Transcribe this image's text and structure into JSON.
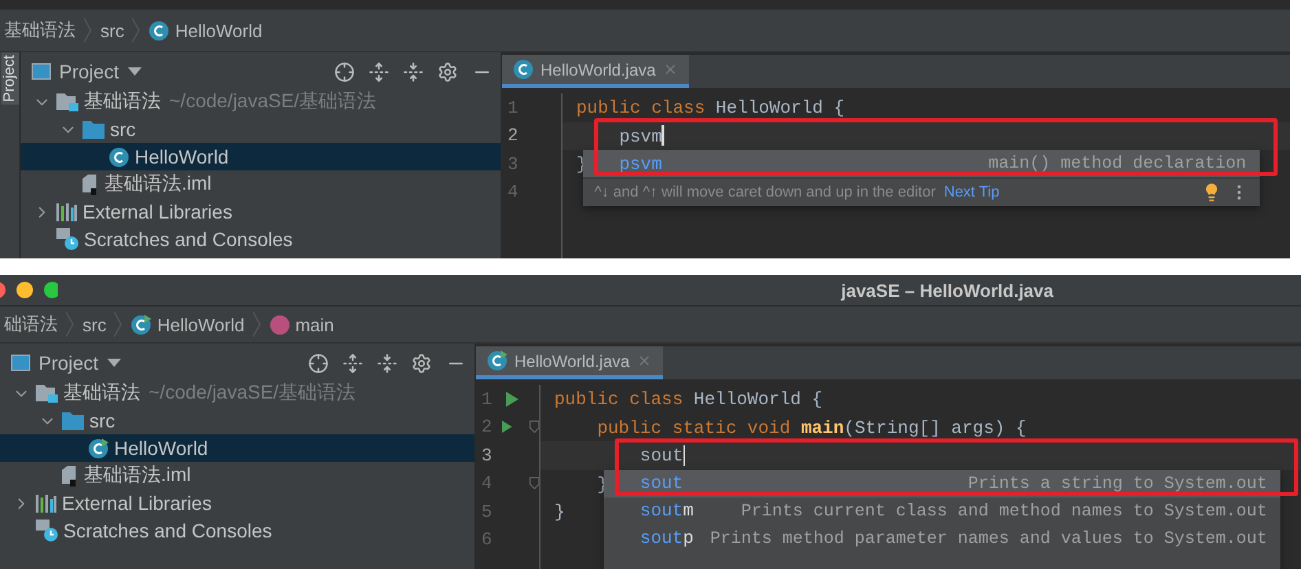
{
  "panels": [
    {
      "kind": "tip",
      "side_tab": "Project",
      "breadcrumbs": [
        {
          "text": "基础语法",
          "kind": "plain"
        },
        {
          "text": "src",
          "kind": "plain"
        },
        {
          "text": "HelloWorld",
          "kind": "class"
        }
      ],
      "project": {
        "title": "Project",
        "tree": [
          {
            "label": "基础语法",
            "hint": "~/code/javaSE/基础语法",
            "kind": "module",
            "expanded": true,
            "selected": false,
            "children": [
              {
                "label": "src",
                "kind": "folder",
                "expanded": true,
                "selected": false,
                "children": [
                  {
                    "label": "HelloWorld",
                    "kind": "class",
                    "selected": true
                  }
                ]
              },
              {
                "label": "基础语法.iml",
                "kind": "file",
                "selected": false
              }
            ]
          },
          {
            "label": "External Libraries",
            "kind": "library",
            "expanded": false,
            "selected": false
          },
          {
            "label": "Scratches and Consoles",
            "kind": "scratches",
            "selected": false
          }
        ]
      },
      "editor": {
        "tab": "HelloWorld.java",
        "lines": [
          {
            "number": "1",
            "current": false,
            "caret": false,
            "tokens": [
              {
                "text": "public class ",
                "kind": "keyword"
              },
              {
                "text": "HelloWorld {",
                "kind": "plain"
              }
            ]
          },
          {
            "number": "2",
            "current": true,
            "caret": true,
            "tokens": [
              {
                "text": "    psvm",
                "kind": "plain"
              }
            ]
          },
          {
            "number": "3",
            "current": false,
            "caret": false,
            "tokens": [
              {
                "text": "}",
                "kind": "plain"
              }
            ]
          },
          {
            "number": "4",
            "current": false,
            "caret": false
          }
        ],
        "completion": {
          "framed": true,
          "items": [
            {
              "match": "psvm",
              "description": "main() method declaration",
              "selected": true
            }
          ],
          "tip": {
            "text": "^↓ and ^↑ will move caret down and up in the editor",
            "link": "Next Tip"
          }
        }
      }
    },
    {
      "kind": "window",
      "window_title": "javaSE – HelloWorld.java",
      "breadcrumbs": [
        {
          "text": "础语法",
          "kind": "plain"
        },
        {
          "text": "src",
          "kind": "plain"
        },
        {
          "text": "HelloWorld",
          "kind": "runclass"
        },
        {
          "text": "main",
          "kind": "method"
        }
      ],
      "project": {
        "title": "Project",
        "tree": [
          {
            "label": "基础语法",
            "hint": "~/code/javaSE/基础语法",
            "kind": "module",
            "expanded": true,
            "selected": false,
            "children": [
              {
                "label": "src",
                "kind": "folder",
                "expanded": true,
                "selected": false,
                "children": [
                  {
                    "label": "HelloWorld",
                    "kind": "runclass",
                    "selected": true
                  }
                ]
              },
              {
                "label": "基础语法.iml",
                "kind": "file",
                "selected": false
              }
            ]
          },
          {
            "label": "External Libraries",
            "kind": "library",
            "expanded": false,
            "selected": false
          },
          {
            "label": "Scratches and Consoles",
            "kind": "scratches",
            "selected": false
          }
        ]
      },
      "editor": {
        "tab": "HelloWorld.java",
        "lines": [
          {
            "number": "1",
            "current": false,
            "caret": false,
            "run": true,
            "fold": false,
            "tokens": [
              {
                "text": "public class ",
                "kind": "keyword"
              },
              {
                "text": "HelloWorld {",
                "kind": "plain"
              }
            ]
          },
          {
            "number": "2",
            "current": false,
            "caret": false,
            "run": true,
            "fold": true,
            "tokens": [
              {
                "text": "    public static void ",
                "kind": "keyword"
              },
              {
                "text": "main",
                "kind": "method"
              },
              {
                "text": "(String[] args) {",
                "kind": "plain"
              }
            ]
          },
          {
            "number": "3",
            "current": true,
            "caret": true,
            "run": false,
            "fold": false,
            "tokens": [
              {
                "text": "        sout",
                "kind": "plain"
              }
            ]
          },
          {
            "number": "4",
            "current": false,
            "caret": false,
            "run": false,
            "fold": true,
            "tokens": [
              {
                "text": "    }",
                "kind": "plain"
              }
            ]
          },
          {
            "number": "5",
            "current": false,
            "caret": false,
            "run": false,
            "fold": false,
            "tokens": [
              {
                "text": "}",
                "kind": "plain"
              }
            ]
          },
          {
            "number": "6",
            "current": false,
            "caret": false,
            "run": false,
            "fold": false
          }
        ],
        "completion": {
          "framed": true,
          "items": [
            {
              "match": "sout",
              "description": "Prints a string to System.out",
              "selected": true
            },
            {
              "match": "sout",
              "rest": "m",
              "description": "Prints current class and method names to System.out",
              "selected": false
            },
            {
              "match": "sout",
              "rest": "p",
              "description": "Prints method parameter names and values to System.out",
              "selected": false
            }
          ]
        }
      }
    }
  ]
}
